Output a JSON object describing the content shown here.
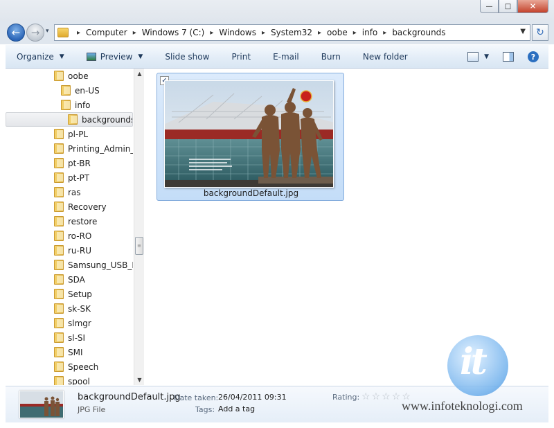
{
  "window": {
    "minimize_glyph": "—",
    "maximize_glyph": "□",
    "close_glyph": "✕"
  },
  "address": {
    "back_glyph": "←",
    "forward_glyph": "→",
    "history_glyph": "▾",
    "crumbs": [
      "Computer",
      "Windows 7 (C:)",
      "Windows",
      "System32",
      "oobe",
      "info",
      "backgrounds"
    ],
    "separator": "▸",
    "dropdown_glyph": "▼",
    "refresh_glyph": "↻"
  },
  "toolbar": {
    "organize": "Organize",
    "preview": "Preview",
    "slideshow": "Slide show",
    "print": "Print",
    "email": "E-mail",
    "burn": "Burn",
    "new_folder": "New folder",
    "caret": "▼",
    "help": "?"
  },
  "tree": [
    {
      "label": "oobe",
      "indent": 0
    },
    {
      "label": "en-US",
      "indent": 1
    },
    {
      "label": "info",
      "indent": 1
    },
    {
      "label": "backgrounds",
      "indent": 2,
      "selected": true
    },
    {
      "label": "pl-PL",
      "indent": 0
    },
    {
      "label": "Printing_Admin_Scripts",
      "indent": 0
    },
    {
      "label": "pt-BR",
      "indent": 0
    },
    {
      "label": "pt-PT",
      "indent": 0
    },
    {
      "label": "ras",
      "indent": 0
    },
    {
      "label": "Recovery",
      "indent": 0
    },
    {
      "label": "restore",
      "indent": 0
    },
    {
      "label": "ro-RO",
      "indent": 0
    },
    {
      "label": "ru-RU",
      "indent": 0
    },
    {
      "label": "Samsung_USB_Drivers",
      "indent": 0
    },
    {
      "label": "SDA",
      "indent": 0
    },
    {
      "label": "Setup",
      "indent": 0
    },
    {
      "label": "sk-SK",
      "indent": 0
    },
    {
      "label": "slmgr",
      "indent": 0
    },
    {
      "label": "sl-SI",
      "indent": 0
    },
    {
      "label": "SMI",
      "indent": 0
    },
    {
      "label": "Speech",
      "indent": 0
    },
    {
      "label": "spool",
      "indent": 0
    }
  ],
  "scrollbar": {
    "up_glyph": "▲",
    "down_glyph": "▼",
    "thumb_glyph": "≡"
  },
  "content": {
    "file_name": "backgroundDefault.jpg",
    "checked_glyph": "✓"
  },
  "details": {
    "file_name": "backgroundDefault.jpg",
    "file_type": "JPG File",
    "date_label": "Date taken:",
    "date_value": "26/04/2011 09:31",
    "rating_label": "Rating:",
    "tags_label": "Tags:",
    "tags_value": "Add a tag",
    "rating_stars": 0,
    "star_glyph": "☆"
  },
  "watermark": {
    "logo": "it",
    "text": "www.infoteknologi.com"
  },
  "colors": {
    "accent": "#2c66b8",
    "selection": "#c4ddf8",
    "toolbar_text": "#1e395b"
  }
}
